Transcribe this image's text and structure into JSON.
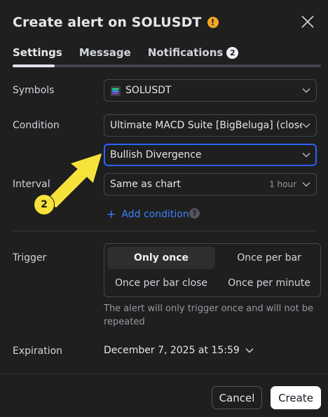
{
  "dialog": {
    "title": "Create alert on SOLUSDT",
    "warning_icon": "!",
    "close_icon": "close-icon"
  },
  "tabs": [
    {
      "label": "Settings",
      "active": true
    },
    {
      "label": "Message",
      "active": false
    },
    {
      "label": "Notifications",
      "badge": "2",
      "active": false
    }
  ],
  "form": {
    "symbols": {
      "label": "Symbols",
      "value": "SOLUSDT"
    },
    "condition": {
      "label": "Condition",
      "value": "Ultimate MACD Suite [BigBeluga] (close, ...",
      "sub_value": "Bullish Divergence"
    },
    "interval": {
      "label": "Interval",
      "value": "Same as chart",
      "hint": "1 hour"
    },
    "add_condition": {
      "plus": "+",
      "label": "Add condition",
      "help": "?"
    },
    "trigger": {
      "label": "Trigger",
      "options": [
        "Only once",
        "Once per bar",
        "Once per bar close",
        "Once per minute"
      ],
      "selected": "Only once",
      "note": "The alert will only trigger once and will not be repeated"
    },
    "expiration": {
      "label": "Expiration",
      "value": "December 7, 2025 at 15:59"
    }
  },
  "footer": {
    "cancel": "Cancel",
    "create": "Create"
  },
  "annotation": {
    "step": "2",
    "color": "#f7e23b"
  },
  "colors": {
    "accent": "#2962ff",
    "link": "#3d83f8",
    "warning": "#f5a623",
    "background": "#1f1f1f"
  }
}
